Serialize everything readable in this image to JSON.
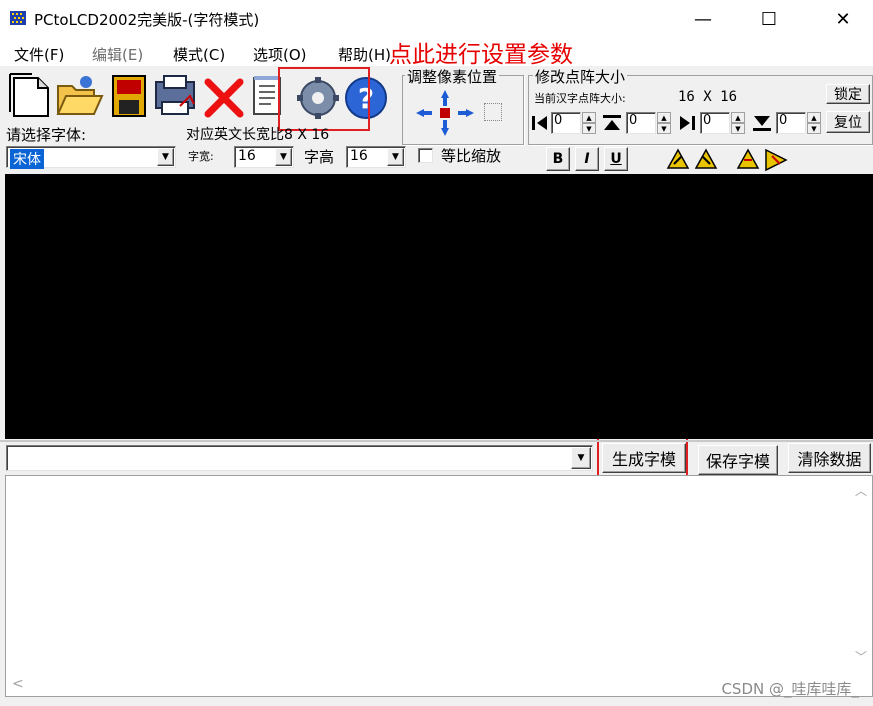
{
  "window": {
    "title": "PCtoLCD2002完美版-(字符模式)",
    "controls": {
      "minimize": "—",
      "maximize": "☐",
      "close": "✕"
    }
  },
  "menu": {
    "file": "文件(F)",
    "edit": "编辑(E)",
    "mode": "模式(C)",
    "options": "选项(O)",
    "help": "帮助(H)"
  },
  "annotation": {
    "text": "点此进行设置参数",
    "color": "#e60000"
  },
  "toolbar": {
    "icons": [
      "new-file-icon",
      "open-folder-icon",
      "save-disk-icon",
      "print-icon",
      "delete-icon",
      "notepad-icon",
      "gear-icon",
      "help-icon"
    ]
  },
  "pixel_adjust": {
    "title": "调整像素位置"
  },
  "matrix": {
    "title": "修改点阵大小",
    "current_label": "当前汉字点阵大小:",
    "current_value": "16 X 16",
    "lock_button": "锁定",
    "reset_button": "复位",
    "spinners": [
      "0",
      "0",
      "0",
      "0"
    ]
  },
  "font": {
    "select_label": "请选择字体:",
    "ascii_size_label": "对应英文长宽比8 X 16",
    "font_value": "宋体",
    "width_label": "字宽:",
    "width_value": "16",
    "height_label": "字高",
    "height_value": "16",
    "proportional_label": "等比缩放",
    "bold": "B",
    "italic": "I",
    "underline": "U"
  },
  "actions": {
    "generate": "生成字模",
    "save": "保存字模",
    "clear": "清除数据"
  },
  "watermark": "CSDN @_哇库哇库_"
}
